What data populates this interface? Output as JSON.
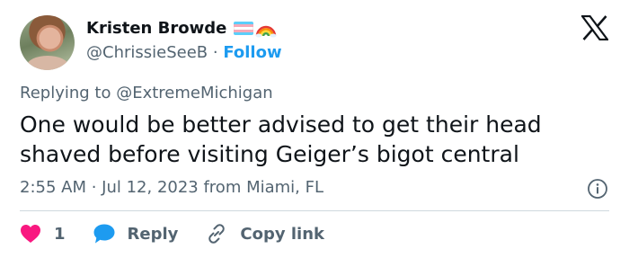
{
  "user": {
    "display_name": "Kristen Browde",
    "handle": "@ChrissieSeeB",
    "separator": " · ",
    "follow_label": "Follow",
    "badges": [
      "transgender-flag-icon",
      "rainbow-icon"
    ]
  },
  "tweet": {
    "replying_prefix": "Replying to ",
    "replying_to": "@ExtremeMichigan",
    "text": "One would be better advised to get their head shaved before visiting Geiger’s bigot central",
    "timestamp": "2:55 AM · Jul 12, 2023 from Miami, FL"
  },
  "actions": {
    "likes_count": "1",
    "reply_label": "Reply",
    "copy_link_label": "Copy link"
  },
  "colors": {
    "accent": "#1d9bf0",
    "like": "#f91880",
    "muted": "#536471",
    "text": "#0f1419"
  }
}
